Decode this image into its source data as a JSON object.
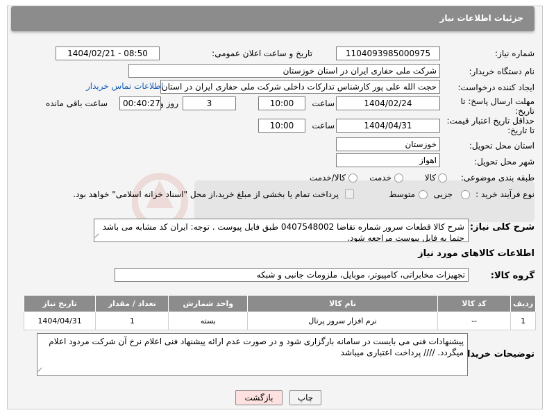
{
  "header": {
    "title": "جزئیات اطلاعات نیاز"
  },
  "labels": {
    "need_number": "شماره نیاز:",
    "announce_datetime": "تاریخ و ساعت اعلان عمومی:",
    "buyer_org": "نام دستگاه خریدار:",
    "requester": "ایجاد کننده درخواست:",
    "reply_deadline_l1": "مهلت ارسال پاسخ: تا",
    "reply_deadline_l2": "تاریخ:",
    "hour": "ساعت",
    "day_and": "روز و",
    "remaining": "ساعت باقی مانده",
    "price_validity_l1": "حداقل تاریخ اعتبار قیمت:",
    "price_validity_l2": "تا تاریخ:",
    "delivery_province": "استان محل تحویل:",
    "delivery_city": "شهر محل تحویل:",
    "category": "طبقه بندی موضوعی:",
    "process_type": "نوع فرآیند خرید :",
    "general_desc": "شرح کلی نیاز:",
    "goods_info": "اطلاعات کالاهای مورد نیاز",
    "goods_group": "گروه کالا:",
    "buyer_notes": "توضیحات خریدار:"
  },
  "values": {
    "need_number": "1104093985000975",
    "announce_datetime": "1404/02/21 - 08:50",
    "buyer_org": "شرکت ملی حفاری ایران در استان خوزستان",
    "requester": "حجت الله علی پور کارشناس تدارکات داخلی شرکت ملی حفاری ایران در استان",
    "contact_link": "اطلاعات تماس خریدار",
    "reply_date": "1404/02/24",
    "reply_time": "10:00",
    "reply_days": "3",
    "reply_remaining": "00:40:27",
    "price_date": "1404/04/31",
    "price_time": "10:00",
    "province": "خوزستان",
    "city": "اهواز",
    "general_desc": "شرح کالا قطعات سرور شماره تقاضا 0407548002 طبق فایل پیوست . توجه: ایران کد مشابه می باشد حتما به فایل پیوست مراجعه شود.",
    "goods_group": "تجهیزات مخابراتی، کامپیوتر، موبایل، ملزومات جانبی و شبکه",
    "buyer_notes": "پیشنهادات فنی می بایست در سامانه بارگزاری شود و در صورت عدم ارائه پیشنهاد فنی اعلام نرخ آن شرکت مردود اعلام میگردد.  //// پرداخت اعتباری میباشد"
  },
  "category_options": [
    "کالا",
    "خدمت",
    "کالا/خدمت"
  ],
  "process_options": [
    "جزیی",
    "متوسط"
  ],
  "process_note": "پرداخت تمام یا بخشی از مبلغ خرید،از محل \"اسناد خزانه اسلامی\" خواهد بود.",
  "table": {
    "headers": [
      "ردیف",
      "کد کالا",
      "نام کالا",
      "واحد شمارش",
      "تعداد / مقدار",
      "تاریخ نیاز"
    ],
    "rows": [
      [
        "1",
        "--",
        "نرم افزار سرور پرتال",
        "بسته",
        "1",
        "1404/04/31"
      ]
    ]
  },
  "buttons": {
    "print": "چاپ",
    "back": "بازگشت"
  },
  "colors": {
    "header_bg": "#8c8c8c",
    "link": "#1a5fb4",
    "back_button_bg": "#fde0e0"
  }
}
